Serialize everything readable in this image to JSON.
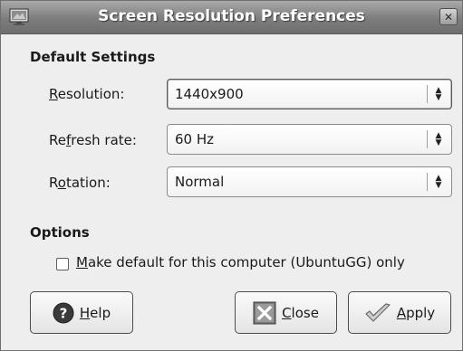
{
  "window": {
    "title": "Screen Resolution Preferences",
    "close_glyph": "✕",
    "title_icon": "monitor-icon"
  },
  "default_settings": {
    "heading": "Default Settings",
    "resolution": {
      "mnemonic": "R",
      "rest": "esolution:",
      "value": "1440x900"
    },
    "refresh_rate": {
      "pre": "Re",
      "mnemonic": "f",
      "rest": "resh rate:",
      "value": "60 Hz"
    },
    "rotation": {
      "pre": "R",
      "mnemonic": "o",
      "rest": "tation:",
      "value": "Normal"
    }
  },
  "options": {
    "heading": "Options",
    "make_default": {
      "mnemonic": "M",
      "rest": "ake default for this computer (UbuntuGG) only",
      "checked": false
    }
  },
  "buttons": {
    "help": {
      "mnemonic": "H",
      "rest": "elp",
      "icon": "help-icon"
    },
    "close": {
      "mnemonic": "C",
      "rest": "lose",
      "icon": "close-icon"
    },
    "apply": {
      "mnemonic": "A",
      "rest": "pply",
      "icon": "checkmark-icon"
    }
  },
  "colors": {
    "titlebar": "#7d7d7d",
    "dialog_bg": "#eeeeee",
    "help_icon": "#3a3a3a"
  }
}
